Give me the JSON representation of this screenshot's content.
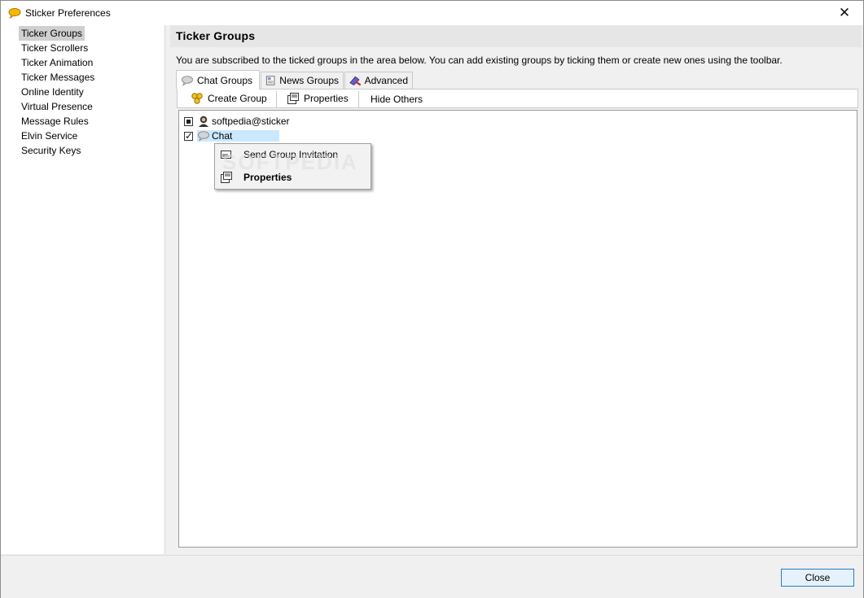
{
  "window": {
    "title": "Sticker Preferences",
    "icon": "speech-bubble-icon"
  },
  "sidebar": {
    "items": [
      {
        "label": "Ticker Groups",
        "selected": true
      },
      {
        "label": "Ticker Scrollers",
        "selected": false
      },
      {
        "label": "Ticker Animation",
        "selected": false
      },
      {
        "label": "Ticker Messages",
        "selected": false
      },
      {
        "label": "Online Identity",
        "selected": false
      },
      {
        "label": "Virtual Presence",
        "selected": false
      },
      {
        "label": "Message Rules",
        "selected": false
      },
      {
        "label": "Elvin Service",
        "selected": false
      },
      {
        "label": "Security Keys",
        "selected": false
      }
    ]
  },
  "main": {
    "title": "Ticker Groups",
    "description": "You are subscribed to the ticked groups in the area below. You can add existing groups by ticking them or create new ones using the toolbar.",
    "tabs": [
      {
        "label": "Chat Groups",
        "icon": "chat-bubble-icon",
        "active": true
      },
      {
        "label": "News Groups",
        "icon": "newspaper-icon",
        "active": false
      },
      {
        "label": "Advanced",
        "icon": "advanced-icon",
        "active": false
      }
    ],
    "toolbar": {
      "create_group": "Create Group",
      "properties": "Properties",
      "hide_others": "Hide Others"
    },
    "groups": [
      {
        "label": "softpedia@sticker",
        "state": "partial",
        "icon": "user-icon"
      },
      {
        "label": "Chat",
        "state": "checked",
        "icon": "chat-bubble-icon"
      }
    ]
  },
  "context_menu": {
    "items": [
      {
        "label": "Send Group Invitation",
        "icon": "invitation-icon",
        "bold": false
      },
      {
        "label": "Properties",
        "icon": "properties-icon",
        "bold": true
      }
    ]
  },
  "watermark": "SOFTPEDIA",
  "footer": {
    "close_label": "Close"
  },
  "colors": {
    "selection": "#cce8ff",
    "button_border": "#2b7ad0",
    "button_bg": "#e5f1fb"
  }
}
